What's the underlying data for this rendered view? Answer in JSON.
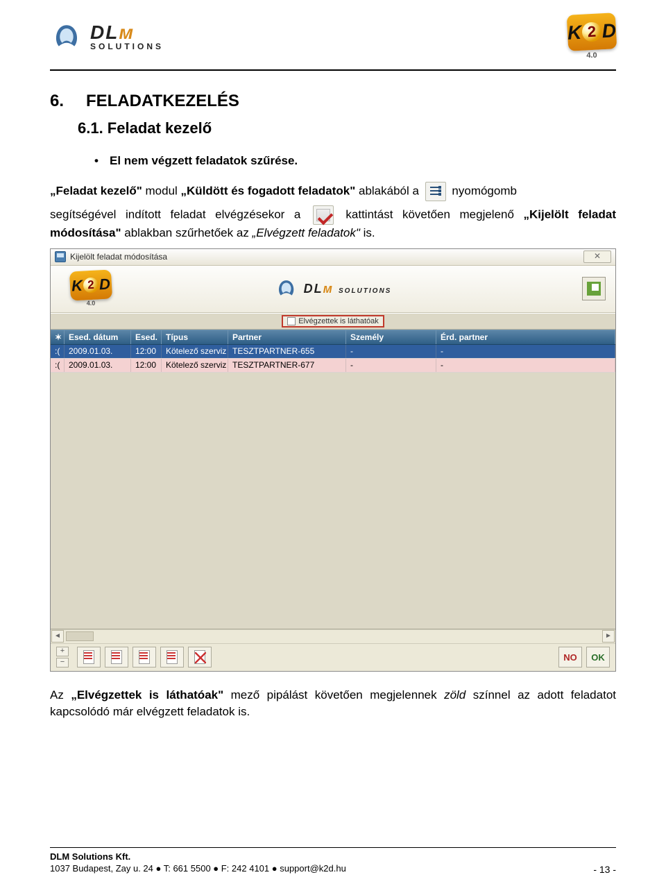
{
  "header": {
    "company_top": "DL",
    "company_swirl": "ᴍ",
    "company_sub": "SOLUTIONS",
    "k2d_k": "K",
    "k2d_2": "2",
    "k2d_d": "D",
    "k2d_ver": "4.0"
  },
  "section": {
    "num": "6.",
    "title": "FELADATKEZELÉS",
    "sub": "6.1.  Feladat kezelő",
    "bullet": "El nem végzett feladatok szűrése."
  },
  "para1": {
    "t1": "„Feladat kezelő\"",
    "t2": " modul ",
    "t3": "„Küldött és fogadott feladatok\"",
    "t4": " ablakából a ",
    "t5": " nyomógomb"
  },
  "para2": {
    "t1": "segítségével indított feladat elvégzésekor a ",
    "t2": " kattintást követően megjelenő ",
    "t3": "„Kijelölt feladat módosítása\"",
    "t4": " ablakban szűrhetőek az ",
    "t5": "„Elvégzett feladatok\"",
    "t6": " is."
  },
  "app": {
    "title": "Kijelölt feladat módosítása",
    "banner_sub": "SOLUTIONS",
    "banner_ver": "4.0",
    "filter_label": "Elvégzettek is láthatóak",
    "headers": {
      "date": "Esed. dátum",
      "time": "Esed.",
      "type": "Típus",
      "partner": "Partner",
      "person": "Személy",
      "erd": "Érd. partner"
    },
    "rows": [
      {
        "mood": ":(",
        "date": "2009.01.03.",
        "time": "12:00",
        "type": "Kötelező szerviz",
        "partner": "TESZTPARTNER-655",
        "person": "-",
        "erd": "-"
      },
      {
        "mood": ":(",
        "date": "2009.01.03.",
        "time": "12:00",
        "type": "Kötelező szerviz",
        "partner": "TESZTPARTNER-677",
        "person": "-",
        "erd": "-"
      }
    ],
    "btn_no": "NO",
    "btn_ok": "OK"
  },
  "para3": {
    "t1": "Az ",
    "t2": "„Elvégzettek is láthatóak\"",
    "t3": " mező pipálást követően megjelennek ",
    "t4": "zöld",
    "t5": " színnel az adott feladatot kapcsolódó már elvégzett feladatok is."
  },
  "footer": {
    "company": "DLM Solutions Kft.",
    "line2": "1037 Budapest, Zay u. 24  ●  T: 661 5500 ● F: 242 4101 ● support@k2d.hu",
    "page": "- 13 -"
  }
}
